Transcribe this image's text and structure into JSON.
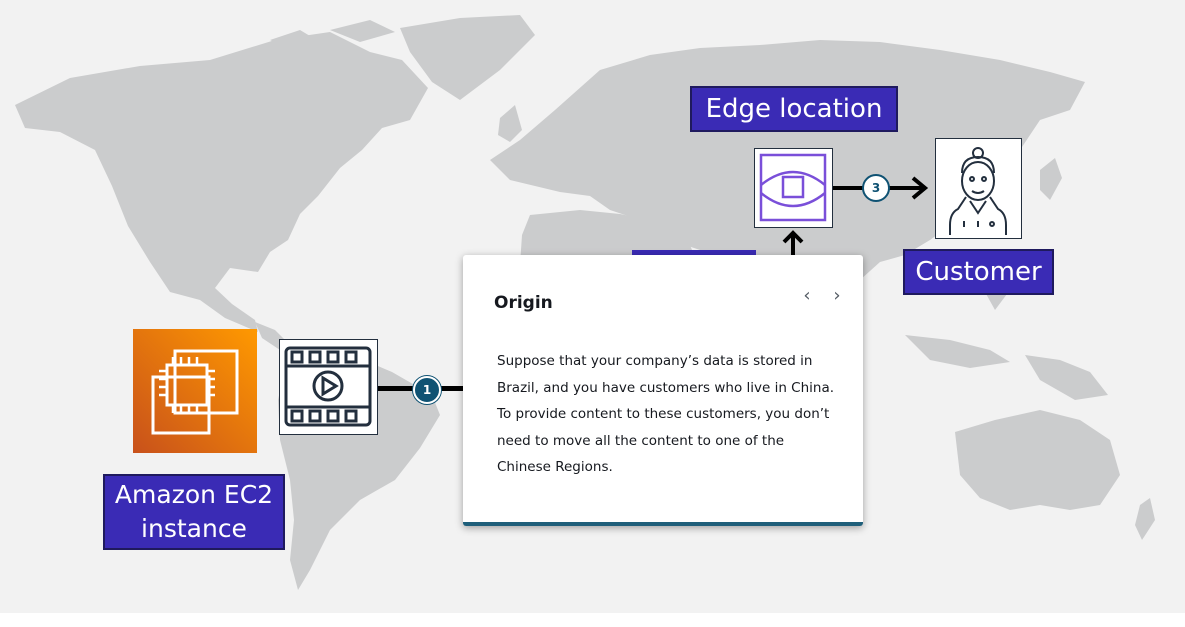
{
  "labels": {
    "edge_location": "Edge location",
    "customer": "Customer",
    "ec2_instance": "Amazon EC2\ninstance"
  },
  "steps": {
    "step1": "1",
    "step3": "3"
  },
  "popover": {
    "title": "Origin",
    "prev_label": "‹",
    "next_label": "›",
    "body": "Suppose that your company’s data is stored in Brazil, and you have customers who live in China. To provide content to these customers, you don’t need to move all the content to one of the Chinese Regions."
  },
  "icons": {
    "ec2": "ec2-instance-icon",
    "video": "video-content-icon",
    "edge": "edge-location-icon",
    "customer": "customer-person-icon"
  },
  "colors": {
    "label_bg": "#3a2bb5",
    "map": "#c8c9cb",
    "badge": "#0f5273",
    "edge_icon": "#7a4fd9"
  }
}
